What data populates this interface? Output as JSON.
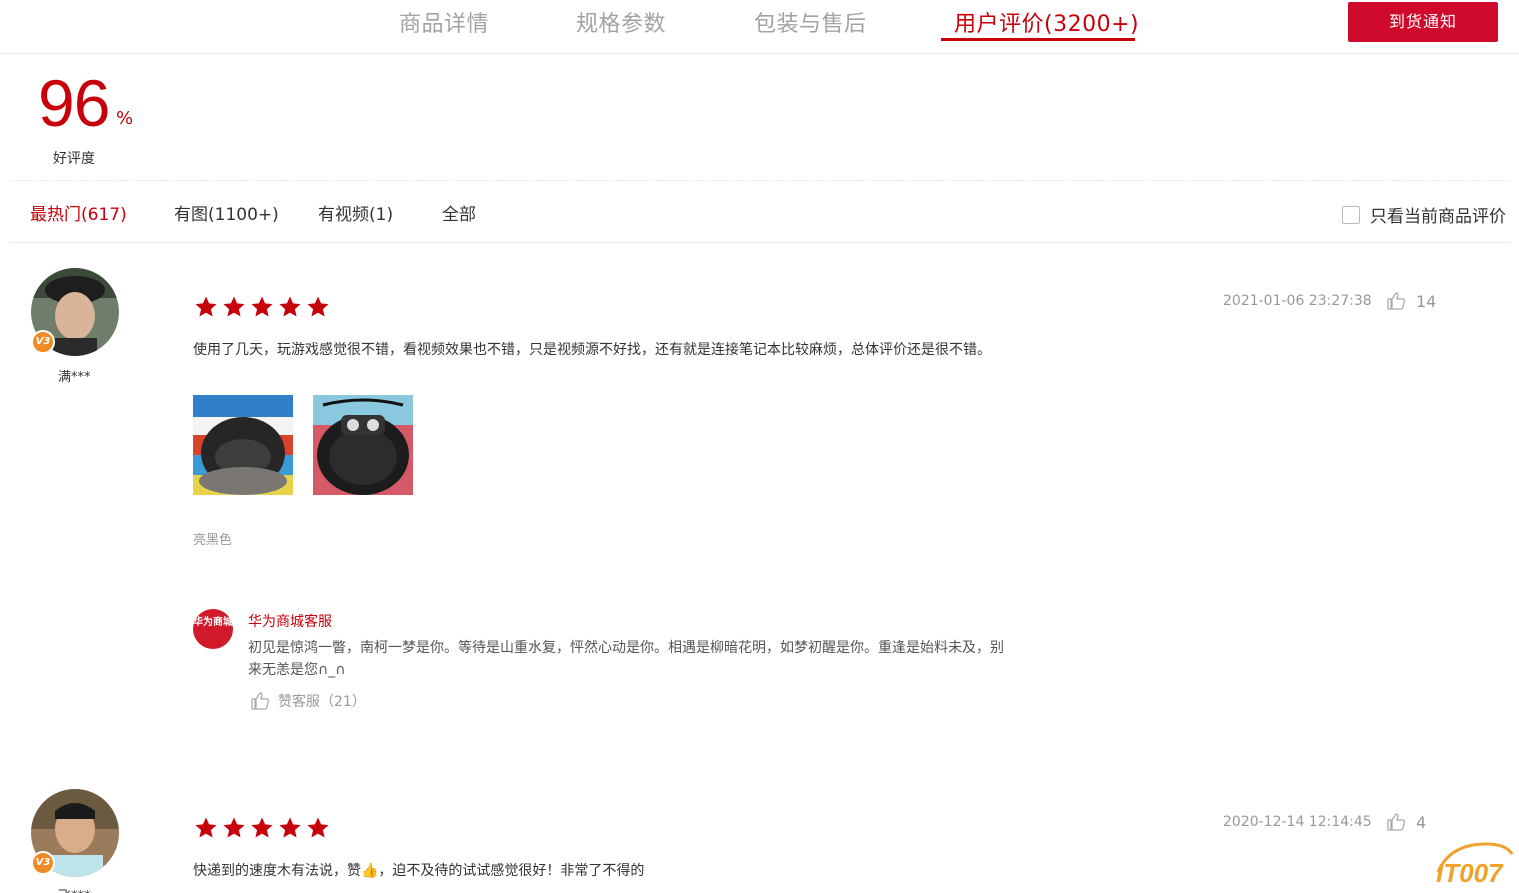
{
  "tabs": [
    {
      "label": "商品详情"
    },
    {
      "label": "规格参数"
    },
    {
      "label": "包装与售后"
    },
    {
      "label": "用户评价(3200+)"
    }
  ],
  "notify_button": "到货通知",
  "rating": {
    "value": "96",
    "unit": "%",
    "label": "好评度"
  },
  "filters": [
    {
      "label": "最热门(617)"
    },
    {
      "label": "有图(1100+)"
    },
    {
      "label": "有视频(1)"
    },
    {
      "label": "全部"
    }
  ],
  "only_current_label": "只看当前商品评价",
  "reviews": [
    {
      "user": "满***",
      "badge": "V3",
      "stars": 5,
      "text": "使用了几天，玩游戏感觉很不错，看视频效果也不错，只是视频源不好找，还有就是连接笔记本比较麻烦，总体评价还是很不错。",
      "time": "2021-01-06 23:27:38",
      "likes": "14",
      "spec": "亮黑色",
      "reply": {
        "logo_text": "华为商城",
        "name": "华为商城客服",
        "text": "初见是惊鸿一瞥，南柯一梦是你。等待是山重水复，怦然心动是你。相遇是柳暗花明，如梦初醒是你。重逢是始料未及，别来无恙是您∩_∩",
        "like_label": "赞客服（21）"
      }
    },
    {
      "user": "飞***",
      "badge": "V3",
      "stars": 5,
      "text": "快递到的速度木有法说，赞👍，迫不及待的试试感觉很好！非常了不得的",
      "time": "2020-12-14 12:14:45",
      "likes": "4"
    }
  ],
  "watermark": "IT007",
  "colors": {
    "accent": "#c7000b",
    "button": "#cf0a2c",
    "badge": "#f08a24"
  }
}
